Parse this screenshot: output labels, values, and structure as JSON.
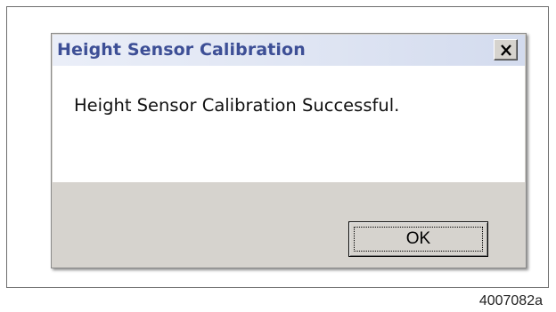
{
  "dialog": {
    "title": "Height Sensor Calibration",
    "close_icon": "close-icon",
    "message": "Height Sensor Calibration Successful.",
    "ok_label": "OK"
  },
  "figure": {
    "caption": "4007082a"
  },
  "colors": {
    "title_text": "#3d4f96",
    "dialog_face": "#d6d3ce",
    "message_area": "#ffffff"
  }
}
